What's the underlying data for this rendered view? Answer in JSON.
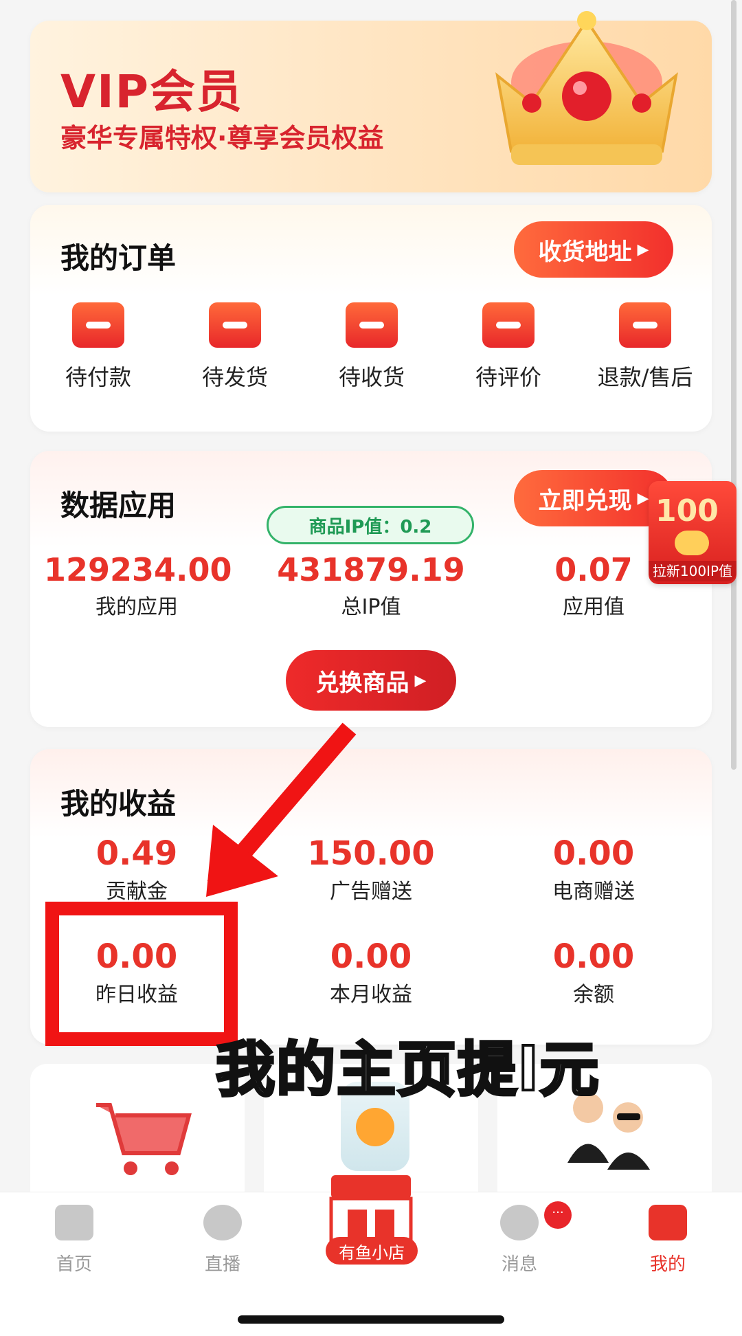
{
  "vip": {
    "title": "VIP会员",
    "subtitle": "豪华专属特权·尊享会员权益"
  },
  "orders": {
    "title": "我的订单",
    "address_button": "收货地址",
    "items": [
      {
        "label": "待付款",
        "icon": "wallet-icon"
      },
      {
        "label": "待发货",
        "icon": "package-icon"
      },
      {
        "label": "待收货",
        "icon": "box-icon"
      },
      {
        "label": "待评价",
        "icon": "comment-icon"
      },
      {
        "label": "退款/售后",
        "icon": "refund-icon"
      }
    ]
  },
  "data_app": {
    "title": "数据应用",
    "cash_button": "立即兑现",
    "ip_tag": "商品IP值：0.2",
    "stats": [
      {
        "value": "129234.00",
        "label": "我的应用"
      },
      {
        "value": "431879.19",
        "label": "总IP值"
      },
      {
        "value": "0.07",
        "label": "应用值"
      }
    ],
    "redeem_button": "兑换商品",
    "badge": {
      "big": "100",
      "small": "拉新100IP值"
    }
  },
  "earnings": {
    "title": "我的收益",
    "stats": [
      {
        "value": "0.49",
        "label": "贡献金"
      },
      {
        "value": "150.00",
        "label": "广告赠送"
      },
      {
        "value": "0.00",
        "label": "电商赠送"
      },
      {
        "value": "0.00",
        "label": "昨日收益"
      },
      {
        "value": "0.00",
        "label": "本月收益"
      },
      {
        "value": "0.00",
        "label": "余额"
      }
    ]
  },
  "overlay_caption": "我的主页提l元",
  "tabbar": {
    "tabs": [
      {
        "label": "首页",
        "icon": "home-icon"
      },
      {
        "label": "直播",
        "icon": "play-icon"
      },
      {
        "label": "有鱼小店",
        "icon": "shop-icon"
      },
      {
        "label": "消息",
        "icon": "chat-icon"
      },
      {
        "label": "我的",
        "icon": "profile-icon"
      }
    ],
    "message_badge": "···"
  },
  "colors": {
    "accent": "#e8332a",
    "highlight": "#f01414",
    "ip_tag_green": "#1f9a55"
  }
}
